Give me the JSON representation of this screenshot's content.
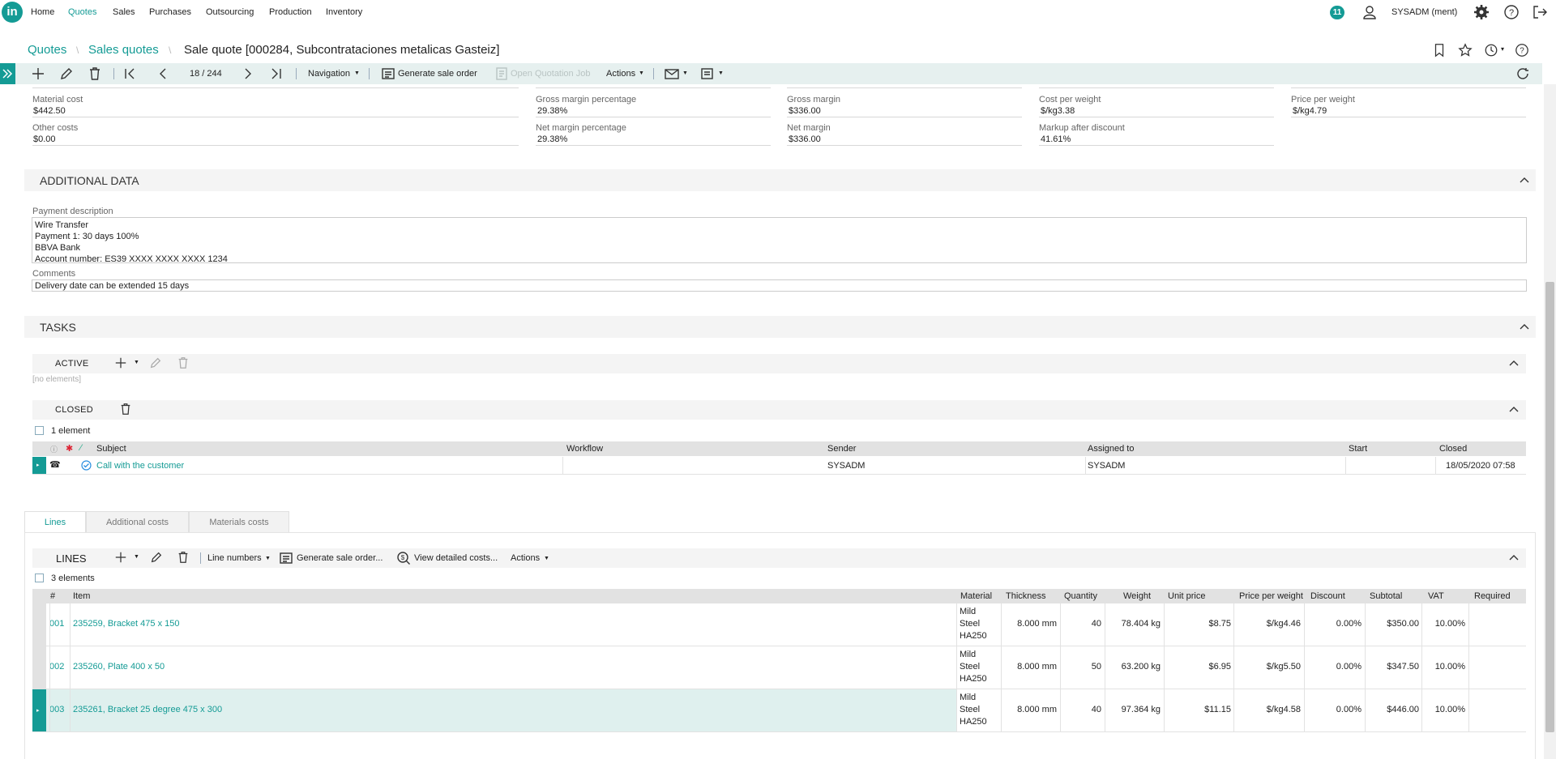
{
  "nav": {
    "logo": "in",
    "items": [
      "Home",
      "Quotes",
      "Sales",
      "Purchases",
      "Outsourcing",
      "Production",
      "Inventory"
    ],
    "active": "Quotes",
    "notifications": "11",
    "user": "SYSADM (ment)"
  },
  "breadcrumb": {
    "level1": "Quotes",
    "level2": "Sales quotes",
    "title": "Sale quote [000284, Subcontrataciones metalicas Gasteiz]"
  },
  "toolbar": {
    "record_position": "18 / 244",
    "navigation": "Navigation",
    "generate_sale_order": "Generate sale order",
    "open_quotation_job": "Open Quotation Job",
    "actions": "Actions"
  },
  "costs": {
    "material_cost_label": "Material cost",
    "material_cost": "$442.50",
    "other_costs_label": "Other costs",
    "other_costs": "$0.00",
    "gross_margin_pct_label": "Gross margin percentage",
    "gross_margin_pct": "29.38%",
    "net_margin_pct_label": "Net margin percentage",
    "net_margin_pct": "29.38%",
    "gross_margin_label": "Gross margin",
    "gross_margin": "$336.00",
    "net_margin_label": "Net margin",
    "net_margin": "$336.00",
    "cost_per_weight_label": "Cost per weight",
    "cost_per_weight": "$/kg3.38",
    "markup_label": "Markup after discount",
    "markup": "41.61%",
    "price_per_weight_label": "Price per weight",
    "price_per_weight": "$/kg4.79"
  },
  "additional": {
    "title": "ADDITIONAL DATA",
    "payment_label": "Payment description",
    "payment_text": "Wire Transfer\nPayment 1: 30 days 100%\nBBVA Bank\nAccount number: ES39 XXXX XXXX XXXX 1234",
    "comments_label": "Comments",
    "comments_text": "Delivery date can be extended 15 days"
  },
  "tasks": {
    "title": "TASKS",
    "active_title": "ACTIVE",
    "no_elements": "[no elements]",
    "closed_title": "CLOSED",
    "closed_count": "1 element",
    "columns": [
      "Subject",
      "Workflow",
      "Sender",
      "Assigned to",
      "Start",
      "Closed"
    ],
    "rows": [
      {
        "subject": "Call with the customer",
        "workflow": "",
        "sender": "SYSADM",
        "assigned": "SYSADM",
        "start": "",
        "closed": "18/05/2020 07:58"
      }
    ]
  },
  "tabs": [
    "Lines",
    "Additional costs",
    "Materials costs"
  ],
  "lines": {
    "title": "LINES",
    "toolbar": {
      "line_numbers": "Line numbers",
      "generate_sale_order": "Generate sale order...",
      "view_costs": "View detailed costs...",
      "actions": "Actions"
    },
    "count": "3 elements",
    "columns": [
      "#",
      "Item",
      "Material",
      "Thickness",
      "Quantity",
      "Weight",
      "Unit price",
      "Price per weight",
      "Discount",
      "Subtotal",
      "VAT",
      "Required"
    ],
    "rows": [
      {
        "num": "001",
        "item": "235259, Bracket 475 x 150",
        "mat1": "Mild",
        "mat2": "Steel",
        "mat3": "HA250",
        "thickness": "8.000 mm",
        "quantity": "40",
        "weight": "78.404 kg",
        "unit_price": "$8.75",
        "ppw": "$/kg4.46",
        "discount": "0.00%",
        "subtotal": "$350.00",
        "vat": "10.00%",
        "required": ""
      },
      {
        "num": "002",
        "item": "235260, Plate 400 x 50",
        "mat1": "Mild",
        "mat2": "Steel",
        "mat3": "HA250",
        "thickness": "8.000 mm",
        "quantity": "50",
        "weight": "63.200 kg",
        "unit_price": "$6.95",
        "ppw": "$/kg5.50",
        "discount": "0.00%",
        "subtotal": "$347.50",
        "vat": "10.00%",
        "required": ""
      },
      {
        "num": "003",
        "item": "235261, Bracket 25 degree 475 x 300",
        "mat1": "Mild",
        "mat2": "Steel",
        "mat3": "HA250",
        "thickness": "8.000 mm",
        "quantity": "40",
        "weight": "97.364 kg",
        "unit_price": "$11.15",
        "ppw": "$/kg4.58",
        "discount": "0.00%",
        "subtotal": "$446.00",
        "vat": "10.00%",
        "required": ""
      }
    ]
  },
  "colors": {
    "accent": "#149b95",
    "toolbar_bg": "#e6f0ef",
    "selected_row": "#dff0ee"
  }
}
